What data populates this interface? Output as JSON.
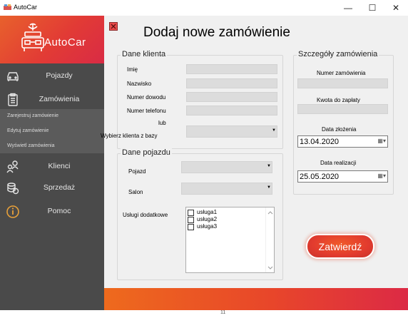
{
  "window": {
    "title": "AutoCar",
    "minimize_glyph": "—",
    "maximize_glyph": "☐",
    "close_glyph": "✕"
  },
  "sidebar": {
    "brand": "AutoCar",
    "items": [
      {
        "label": "Pojazdy",
        "icon": "car-icon"
      },
      {
        "label": "Zamówienia",
        "icon": "clipboard-icon"
      },
      {
        "label": "Klienci",
        "icon": "users-icon"
      },
      {
        "label": "Sprzedaż",
        "icon": "coins-icon"
      },
      {
        "label": "Pomoc",
        "icon": "info-icon"
      }
    ],
    "submenu": [
      "Zarejestruj zamówienie",
      "Edytuj zamówienie",
      "Wyświetl zamówienia"
    ]
  },
  "main": {
    "title": "Dodaj nowe zamówienie",
    "client": {
      "legend": "Dane klienta",
      "first_name_label": "Imię",
      "last_name_label": "Nazwisko",
      "id_label": "Numer dowodu",
      "phone_label": "Numer telefonu",
      "or_label": "lub",
      "choose_label": "Wybierz klienta z bazy",
      "choose_value": ""
    },
    "vehicle": {
      "legend": "Dane pojazdu",
      "vehicle_label": "Pojazd",
      "salon_label": "Salon",
      "services_label": "Usługi dodatkowe",
      "services": [
        "usługa1",
        "usługa2",
        "usługa3"
      ]
    },
    "details": {
      "legend": "Szczegóły zamówienia",
      "order_number_label": "Numer zamówienia",
      "amount_label": "Kwota do zapłaty",
      "created_label": "Data złożenia",
      "created_value": "13.04.2020",
      "realization_label": "Data realizacji",
      "realization_value": "25.05.2020"
    },
    "confirm_label": "Zatwierdź"
  },
  "footer_mark": "11",
  "colors": {
    "accent": "#e8462a",
    "sidebar": "#4a4a4a",
    "submenu": "#5b5b5b",
    "panel": "#f0f0f0"
  }
}
